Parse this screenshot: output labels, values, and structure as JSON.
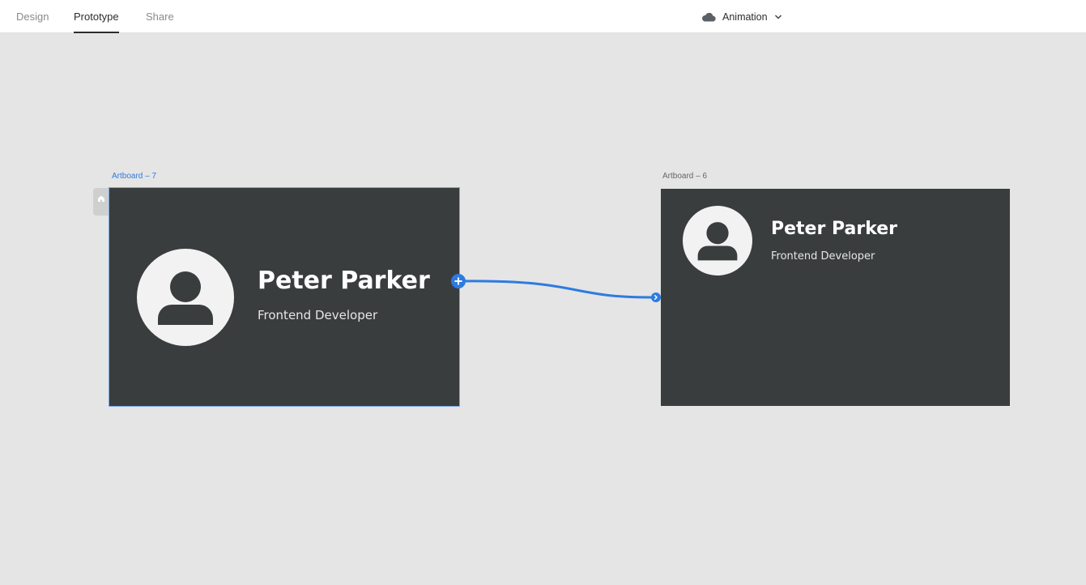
{
  "tabs": [
    {
      "label": "Design",
      "active": false
    },
    {
      "label": "Prototype",
      "active": true
    },
    {
      "label": "Share",
      "active": false
    }
  ],
  "document": {
    "title": "Animation",
    "cloud_icon": "cloud-icon",
    "dropdown_icon": "chevron-down-icon"
  },
  "artboards": [
    {
      "label": "Artboard – 7",
      "selected": true,
      "home": true,
      "name": "Peter Parker",
      "role": "Frontend Developer"
    },
    {
      "label": "Artboard – 6",
      "selected": false,
      "home": false,
      "name": "Peter Parker",
      "role": "Frontend Developer"
    }
  ],
  "colors": {
    "accent": "#2d7be0",
    "artboard_bg": "#3a3d3e",
    "canvas_bg": "#e5e5e5",
    "avatar_bg": "#f2f2f2",
    "avatar_figure": "#3a3d3e"
  }
}
